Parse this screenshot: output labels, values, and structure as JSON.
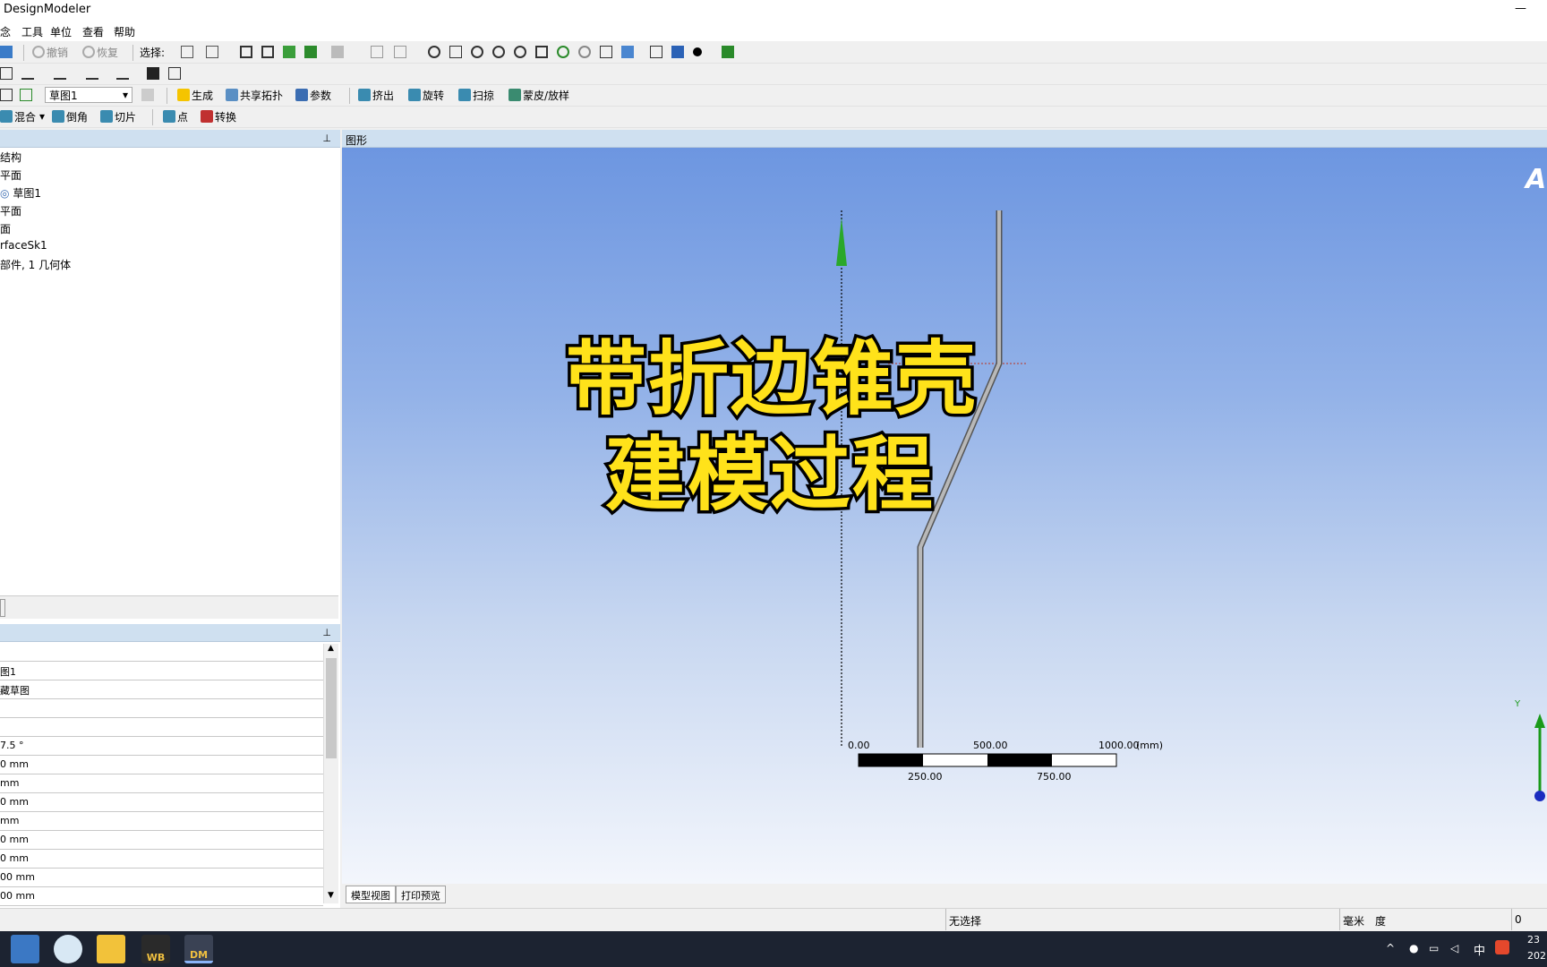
{
  "window": {
    "title": "DesignModeler",
    "minimize": "—"
  },
  "menu": [
    "念",
    "工具",
    "单位",
    "查看",
    "帮助"
  ],
  "toolbar1": {
    "undo": "撤销",
    "redo": "恢复",
    "select_label": "选择:"
  },
  "toolbar3": {
    "sketch_combo": "草图1",
    "generate": "生成",
    "share_topology": "共享拓扑",
    "parameters": "参数",
    "extrude": "挤出",
    "revolve": "旋转",
    "sweep": "扫掠",
    "skin_loft": "蒙皮/放样"
  },
  "toolbar4": {
    "blend": "混合",
    "chamfer": "倒角",
    "slice": "切片",
    "point": "点",
    "conversion": "转换"
  },
  "tree": {
    "items": [
      "结构",
      "平面",
      "草图1",
      "平面",
      "面",
      "rfaceSk1",
      "部件, 1 几何体"
    ]
  },
  "details": {
    "rows": [
      "",
      "图1",
      "藏草图",
      "",
      "",
      "7.5 °",
      "0 mm",
      "mm",
      "0 mm",
      "mm",
      "0 mm",
      "0 mm",
      "00 mm",
      "00 mm"
    ]
  },
  "viewport": {
    "header": "图形",
    "logo": "A"
  },
  "overlay": {
    "line1": "带折边锥壳",
    "line2": "建模过程"
  },
  "scale": {
    "t0": "0.00",
    "t500": "500.00",
    "t1000": "1000.00",
    "unit": "(mm)",
    "t250": "250.00",
    "t750": "750.00"
  },
  "axis": {
    "y": "Y"
  },
  "tabs": {
    "model_view": "模型视图",
    "print_preview": "打印预览"
  },
  "status": {
    "selection": "无选择",
    "units": "毫米",
    "angle": "度",
    "value": "0"
  },
  "taskbar": {
    "wb": "WB",
    "dm": "DM",
    "ime": "中",
    "time": "23",
    "date": "202"
  }
}
